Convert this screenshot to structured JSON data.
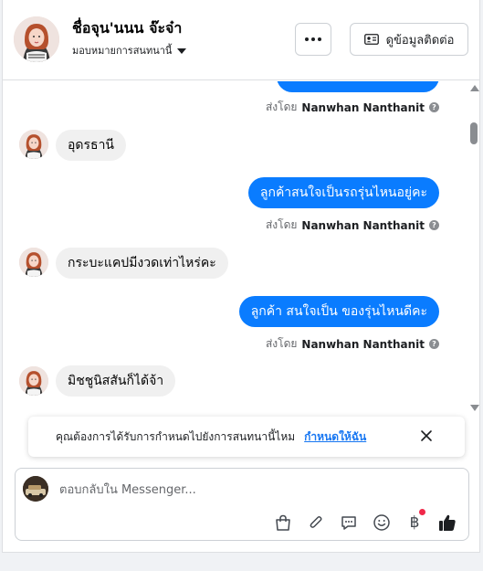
{
  "header": {
    "name": "ชื่อจุน'นนน จ๊ะจ๋า",
    "assign_label": "มอบหมายการสนทนานี้",
    "contact_button_label": "ดูข้อมูลติดต่อ"
  },
  "messages": [
    {
      "type": "outgoing_partial",
      "text": ""
    },
    {
      "type": "sent_by",
      "prefix": "ส่งโดย",
      "sender": "Nanwhan Nanthanit"
    },
    {
      "type": "incoming",
      "text": "อุดรธานี"
    },
    {
      "type": "outgoing",
      "text": "ลูกค้าสนใจเป็นรถรุ่นไหนอยู่คะ"
    },
    {
      "type": "sent_by",
      "prefix": "ส่งโดย",
      "sender": "Nanwhan Nanthanit"
    },
    {
      "type": "incoming",
      "text": "กระบะแคปมีงวดเท่าไหร่คะ"
    },
    {
      "type": "outgoing",
      "text": "ลูกค้า สนใจเป็น ของรุ่นไหนดีคะ"
    },
    {
      "type": "sent_by",
      "prefix": "ส่งโดย",
      "sender": "Nanwhan Nanthanit"
    },
    {
      "type": "incoming",
      "text": "มิชชูนิสสันก็ได้จ้า"
    }
  ],
  "banner": {
    "text": "คุณต้องการได้รับการกำหนดไปยังการสนทนานี้ไหม",
    "link_label": "กำหนดให้ฉัน"
  },
  "composer": {
    "placeholder": "ตอบกลับใน Messenger..."
  },
  "toolbar": {
    "currency_symbol": "฿"
  },
  "colors": {
    "accent": "#0a7cff",
    "link": "#1877f2",
    "incoming_bubble": "#f0f0f0",
    "notification_dot": "#f02849"
  }
}
